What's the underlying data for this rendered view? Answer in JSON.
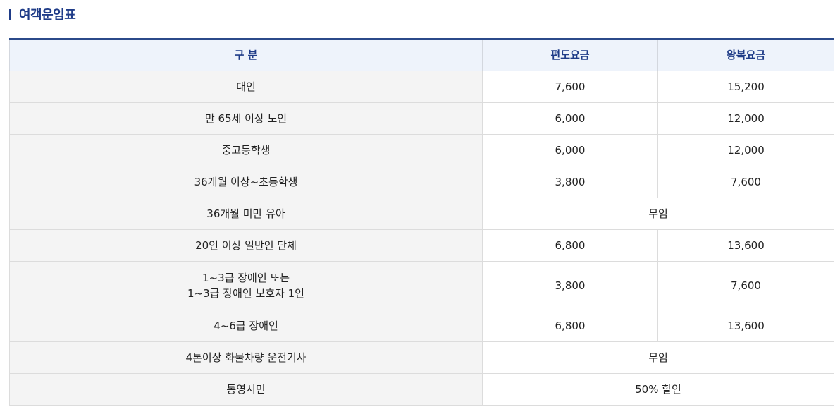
{
  "section_title": "여객운임표",
  "table": {
    "headers": [
      "구 분",
      "편도요금",
      "왕복요금"
    ],
    "rows": [
      {
        "category": "대인",
        "one_way": "7,600",
        "round_trip": "15,200"
      },
      {
        "category": "만 65세 이상 노인",
        "one_way": "6,000",
        "round_trip": "12,000"
      },
      {
        "category": "중고등학생",
        "one_way": "6,000",
        "round_trip": "12,000"
      },
      {
        "category": "36개월 이상~초등학생",
        "one_way": "3,800",
        "round_trip": "7,600"
      },
      {
        "category": "36개월 미만 유아",
        "merged": "무임"
      },
      {
        "category": "20인 이상 일반인 단체",
        "one_way": "6,800",
        "round_trip": "13,600"
      },
      {
        "category_lines": [
          "1~3급 장애인 또는",
          "1~3급 장애인 보호자 1인"
        ],
        "one_way": "3,800",
        "round_trip": "7,600"
      },
      {
        "category": "4~6급 장애인",
        "one_way": "6,800",
        "round_trip": "13,600"
      },
      {
        "category": "4톤이상 화물차량 운전기사",
        "merged": "무임"
      },
      {
        "category": "통영시민",
        "merged": "50% 할인"
      }
    ]
  }
}
